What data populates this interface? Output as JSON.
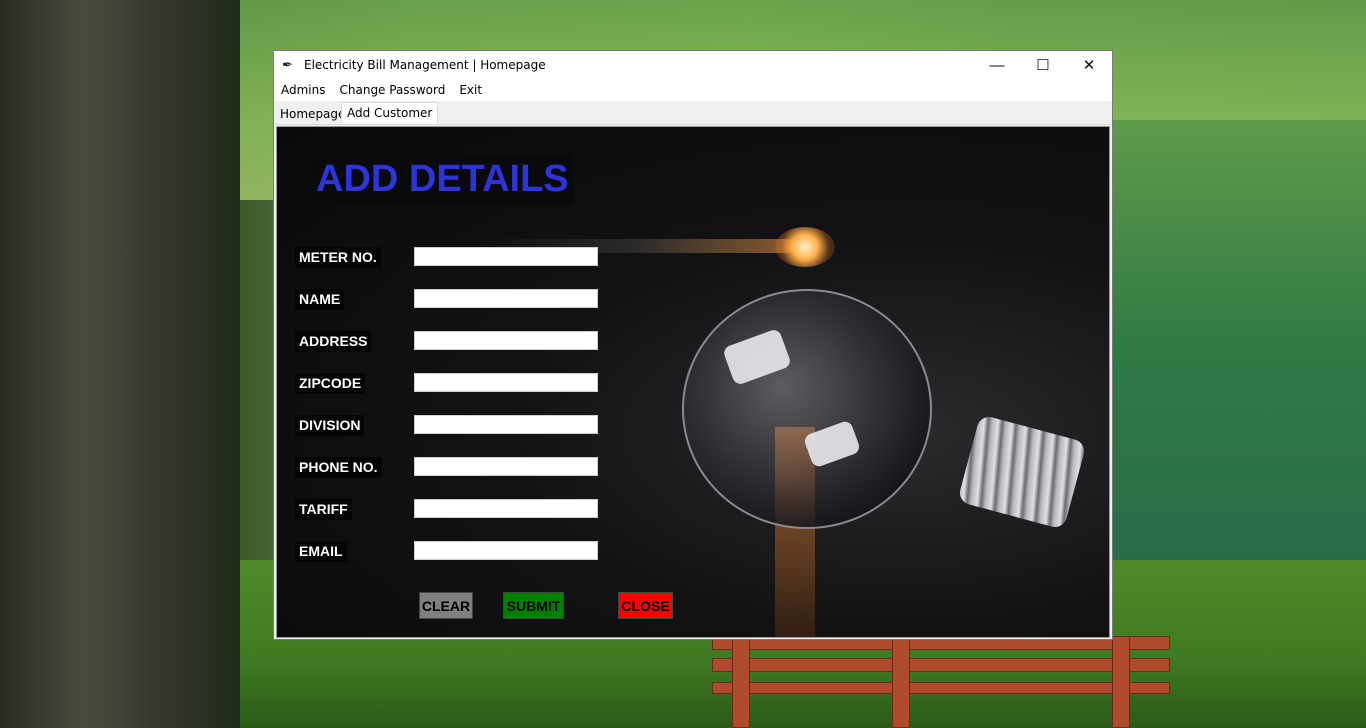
{
  "window": {
    "title": "Electricity Bill Management | Homepage",
    "controls": {
      "minimize": "—",
      "maximize": "☐",
      "close": "✕"
    }
  },
  "menu": {
    "items": [
      "Admins",
      "Change Password",
      "Exit"
    ]
  },
  "tabs": [
    {
      "label": "Homepage",
      "active": false
    },
    {
      "label": "Add Customer",
      "active": true
    }
  ],
  "form": {
    "heading": "ADD DETAILS",
    "fields": [
      {
        "label": "METER NO.",
        "value": ""
      },
      {
        "label": "NAME",
        "value": ""
      },
      {
        "label": "ADDRESS",
        "value": ""
      },
      {
        "label": "ZIPCODE",
        "value": ""
      },
      {
        "label": "DIVISION",
        "value": ""
      },
      {
        "label": "PHONE NO.",
        "value": ""
      },
      {
        "label": "TARIFF",
        "value": ""
      },
      {
        "label": "EMAIL",
        "value": ""
      }
    ],
    "buttons": {
      "clear": {
        "label": "CLEAR",
        "color": "#808080"
      },
      "submit": {
        "label": "SUBMIT",
        "color": "#008000"
      },
      "close": {
        "label": "CLOSE",
        "color": "#ff0000"
      }
    }
  },
  "colors": {
    "heading_text": "#2b35d9",
    "content_bg": "#0a0a0c"
  }
}
